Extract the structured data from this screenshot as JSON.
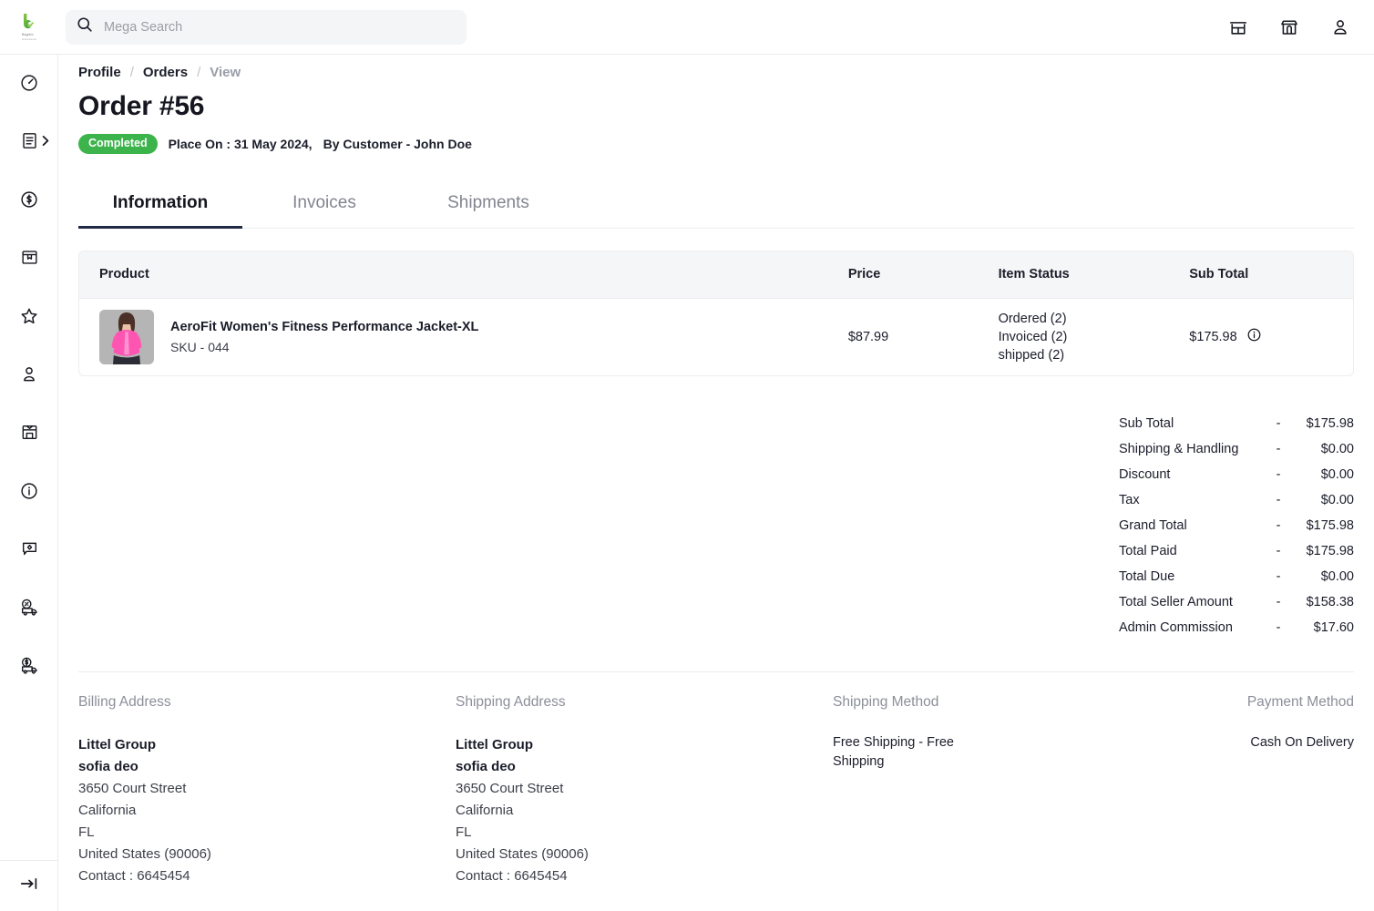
{
  "topbar": {
    "logo_name": "bagisto-logo",
    "logo_word_main": "Bagisto",
    "logo_word_sub": "eCommerce",
    "search": {
      "value": "",
      "placeholder": "Mega Search"
    },
    "icons": [
      {
        "name": "storefront-icon",
        "label": "Storefront"
      },
      {
        "name": "shop-icon",
        "label": "Shop"
      },
      {
        "name": "user-account-icon",
        "label": "Account"
      }
    ]
  },
  "sidebar": {
    "items": [
      {
        "name": "dashboard-icon",
        "label": "Dashboard"
      },
      {
        "name": "orders-icon",
        "label": "Sales"
      },
      {
        "name": "dollar-circle-icon",
        "label": "Transactions"
      },
      {
        "name": "catalog-box-icon",
        "label": "Catalog"
      },
      {
        "name": "star-icon",
        "label": "Reviews"
      },
      {
        "name": "customer-icon",
        "label": "Customers"
      },
      {
        "name": "inbox-icon",
        "label": "Inventory"
      },
      {
        "name": "info-circle-icon",
        "label": "Information"
      },
      {
        "name": "chat-flag-icon",
        "label": "Messages"
      },
      {
        "name": "delivery-discount-icon",
        "label": "Shipping Discount"
      },
      {
        "name": "delivery-payment-icon",
        "label": "Shipping Payment"
      }
    ],
    "collapse": {
      "name": "collapse-sidebar-icon",
      "label": "Collapse"
    }
  },
  "breadcrumb": {
    "profile": "Profile",
    "orders": "Orders",
    "current": "View",
    "separator": "/"
  },
  "page": {
    "title": "Order #56",
    "status_badge": "Completed",
    "placed_on": "Place On : 31 May 2024,",
    "by_customer": "By Customer - John Doe",
    "status_color": "#3cb44b"
  },
  "tabs": [
    {
      "label": "Information",
      "active": true
    },
    {
      "label": "Invoices",
      "active": false
    },
    {
      "label": "Shipments",
      "active": false
    }
  ],
  "items_table": {
    "columns": [
      "Product",
      "Price",
      "Item Status",
      "Sub Total"
    ],
    "rows": [
      {
        "product_name": "AeroFit Women's Fitness Performance Jacket-XL",
        "sku": "SKU - 044",
        "price": "$87.99",
        "status_lines": [
          "Ordered (2)",
          "Invoiced (2)",
          "shipped (2)"
        ],
        "sub_total": "$175.98",
        "info_icon": "info-circle-icon"
      }
    ]
  },
  "totals": {
    "dash": "-",
    "rows": [
      {
        "label": "Sub Total",
        "value": "$175.98"
      },
      {
        "label": "Shipping & Handling",
        "value": "$0.00"
      },
      {
        "label": "Discount",
        "value": "$0.00"
      },
      {
        "label": "Tax",
        "value": "$0.00"
      },
      {
        "label": "Grand Total",
        "value": "$175.98"
      },
      {
        "label": "Total Paid",
        "value": "$175.98"
      },
      {
        "label": "Total Due",
        "value": "$0.00"
      },
      {
        "label": "Total Seller Amount",
        "value": "$158.38"
      },
      {
        "label": "Admin Commission",
        "value": "$17.60"
      }
    ]
  },
  "billing": {
    "heading": "Billing Address",
    "company": "Littel Group",
    "person": "sofia deo",
    "street": "3650 Court Street",
    "city": "California",
    "state": "FL",
    "country": "United States (90006)",
    "contact": "Contact : 6645454"
  },
  "shipping": {
    "heading": "Shipping Address",
    "company": "Littel Group",
    "person": "sofia deo",
    "street": "3650 Court Street",
    "city": "California",
    "state": "FL",
    "country": "United States (90006)",
    "contact": "Contact : 6645454"
  },
  "shipping_method": {
    "heading": "Shipping Method",
    "value": "Free Shipping - Free Shipping"
  },
  "payment_method": {
    "heading": "Payment Method",
    "value": "Cash On Delivery"
  }
}
